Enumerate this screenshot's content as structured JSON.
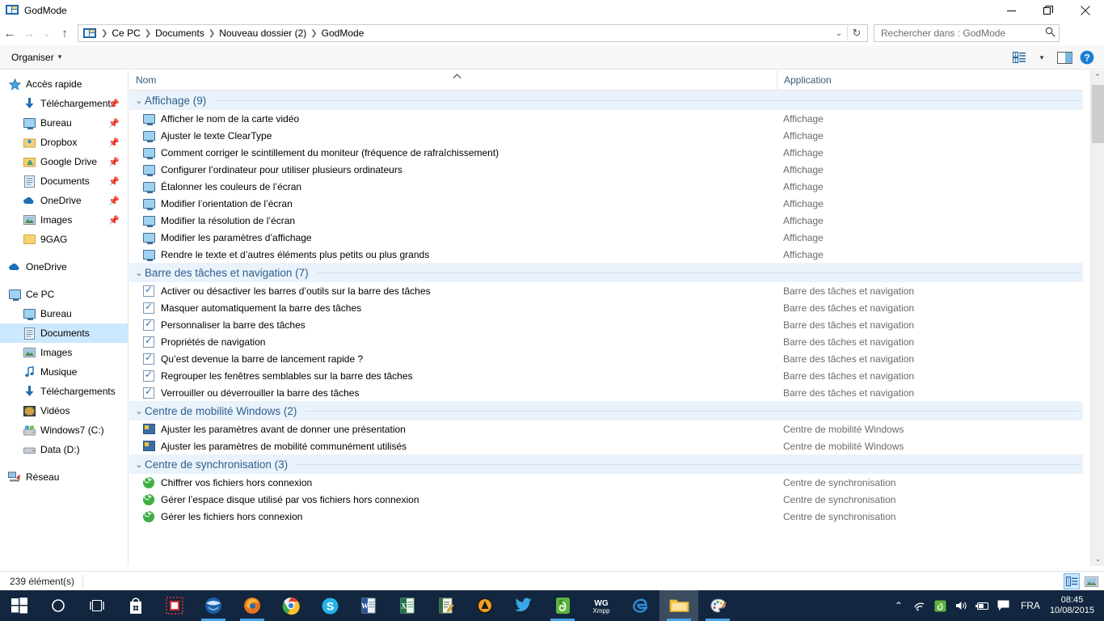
{
  "window": {
    "title": "GodMode",
    "icon": "godmode-icon",
    "controls": {
      "minimize": "—",
      "maximize": "❐",
      "close": "✕"
    }
  },
  "nav": {
    "back": "←",
    "forward": "→",
    "recent": "⌄",
    "up": "↑",
    "breadcrumbs": [
      "Ce PC",
      "Documents",
      "Nouveau dossier (2)",
      "GodMode"
    ],
    "dropdown": "⌄",
    "refresh": "↻",
    "search": {
      "placeholder": "Rechercher dans : GodMode",
      "value": "",
      "icon": "search-icon"
    }
  },
  "commandbar": {
    "organiser": "Organiser",
    "organiser_caret": "▾",
    "view_options": "view-options-icon",
    "view_caret": "▾",
    "preview_pane": "preview-pane-icon",
    "help": "?"
  },
  "sidebar": {
    "groups": [
      {
        "header": {
          "label": "Accès rapide",
          "icon": "star-icon",
          "level": 0
        },
        "items": [
          {
            "label": "Téléchargements",
            "icon": "download-arrow-icon",
            "pinned": true
          },
          {
            "label": "Bureau",
            "icon": "desktop-monitor-icon",
            "pinned": true
          },
          {
            "label": "Dropbox",
            "icon": "dropbox-icon",
            "pinned": true
          },
          {
            "label": "Google Drive",
            "icon": "google-drive-icon",
            "pinned": true
          },
          {
            "label": "Documents",
            "icon": "documents-icon",
            "pinned": true
          },
          {
            "label": "OneDrive",
            "icon": "onedrive-cloud-icon",
            "pinned": true
          },
          {
            "label": "Images",
            "icon": "pictures-icon",
            "pinned": true
          },
          {
            "label": "9GAG",
            "icon": "folder-icon",
            "pinned": false
          }
        ]
      },
      {
        "header": {
          "label": "OneDrive",
          "icon": "onedrive-cloud-icon",
          "level": 0
        },
        "items": []
      },
      {
        "header": {
          "label": "Ce PC",
          "icon": "this-pc-icon",
          "level": 0
        },
        "items": [
          {
            "label": "Bureau",
            "icon": "desktop-monitor-icon",
            "pinned": false
          },
          {
            "label": "Documents",
            "icon": "documents-icon",
            "pinned": false,
            "selected": true
          },
          {
            "label": "Images",
            "icon": "pictures-icon",
            "pinned": false
          },
          {
            "label": "Musique",
            "icon": "music-note-icon",
            "pinned": false
          },
          {
            "label": "Téléchargements",
            "icon": "download-arrow-icon",
            "pinned": false
          },
          {
            "label": "Vidéos",
            "icon": "videos-icon",
            "pinned": false
          },
          {
            "label": "Windows7 (C:)",
            "icon": "system-drive-icon",
            "pinned": false
          },
          {
            "label": "Data (D:)",
            "icon": "drive-icon",
            "pinned": false
          }
        ]
      },
      {
        "header": {
          "label": "Réseau",
          "icon": "network-icon",
          "level": 0
        },
        "items": []
      }
    ]
  },
  "list": {
    "columns": [
      {
        "label": "Nom",
        "sort": "asc"
      },
      {
        "label": "Application",
        "sort": null
      }
    ],
    "groups": [
      {
        "title": "Affichage (9)",
        "chevron": "⌄",
        "icon": "display-monitor-icon",
        "items": [
          {
            "name": "Afficher le nom de la carte vidéo",
            "app": "Affichage"
          },
          {
            "name": "Ajuster le texte ClearType",
            "app": "Affichage"
          },
          {
            "name": "Comment corriger le scintillement du moniteur (fréquence de rafraîchissement)",
            "app": "Affichage"
          },
          {
            "name": "Configurer l’ordinateur pour utiliser plusieurs ordinateurs",
            "app": "Affichage"
          },
          {
            "name": "Étalonner les couleurs de l’écran",
            "app": "Affichage"
          },
          {
            "name": "Modifier l’orientation de l’écran",
            "app": "Affichage"
          },
          {
            "name": "Modifier la résolution de l’écran",
            "app": "Affichage"
          },
          {
            "name": "Modifier les paramètres d’affichage",
            "app": "Affichage"
          },
          {
            "name": "Rendre le texte et d’autres éléments plus petits ou plus grands",
            "app": "Affichage"
          }
        ]
      },
      {
        "title": "Barre des tâches et navigation (7)",
        "chevron": "⌄",
        "icon": "taskbar-checkbox-icon",
        "items": [
          {
            "name": "Activer ou désactiver les barres d’outils sur la barre des tâches",
            "app": "Barre des tâches et navigation"
          },
          {
            "name": "Masquer automatiquement la barre des tâches",
            "app": "Barre des tâches et navigation"
          },
          {
            "name": "Personnaliser la barre des tâches",
            "app": "Barre des tâches et navigation"
          },
          {
            "name": "Propriétés de navigation",
            "app": "Barre des tâches et navigation"
          },
          {
            "name": "Qu’est devenue la barre de lancement rapide ?",
            "app": "Barre des tâches et navigation"
          },
          {
            "name": "Regrouper les fenêtres semblables sur la barre des tâches",
            "app": "Barre des tâches et navigation"
          },
          {
            "name": "Verrouiller ou déverrouiller la barre des tâches",
            "app": "Barre des tâches et navigation"
          }
        ]
      },
      {
        "title": "Centre de mobilité Windows (2)",
        "chevron": "⌄",
        "icon": "mobility-center-icon",
        "items": [
          {
            "name": "Ajuster les paramètres avant de donner une présentation",
            "app": "Centre de mobilité Windows"
          },
          {
            "name": "Ajuster les paramètres de mobilité communément utilisés",
            "app": "Centre de mobilité Windows"
          }
        ]
      },
      {
        "title": "Centre de synchronisation (3)",
        "chevron": "⌄",
        "icon": "sync-center-icon",
        "items": [
          {
            "name": "Chiffrer vos fichiers hors connexion",
            "app": "Centre de synchronisation"
          },
          {
            "name": "Gérer l’espace disque utilisé par vos fichiers hors connexion",
            "app": "Centre de synchronisation"
          },
          {
            "name": "Gérer les fichiers hors connexion",
            "app": "Centre de synchronisation"
          }
        ]
      }
    ]
  },
  "statusbar": {
    "item_count": "239 élément(s)",
    "views": [
      {
        "name": "details-view",
        "active": true
      },
      {
        "name": "large-icons-view",
        "active": false
      }
    ]
  },
  "taskbar": {
    "start": "start-button",
    "cortana": "cortana-search-icon",
    "taskview": "task-view-icon",
    "apps": [
      {
        "name": "microsoft-store",
        "label": "Store",
        "running": false,
        "active": false
      },
      {
        "name": "snipping-tool",
        "label": "Capture",
        "running": false,
        "active": false
      },
      {
        "name": "thunderbird",
        "label": "Thunderbird",
        "running": true,
        "active": false
      },
      {
        "name": "firefox",
        "label": "Firefox",
        "running": true,
        "active": false
      },
      {
        "name": "chrome",
        "label": "Chrome",
        "running": false,
        "active": false
      },
      {
        "name": "skype",
        "label": "Skype",
        "running": false,
        "active": false
      },
      {
        "name": "word",
        "label": "Word",
        "running": false,
        "active": false
      },
      {
        "name": "excel",
        "label": "Excel",
        "running": false,
        "active": false
      },
      {
        "name": "notes-app",
        "label": "Notes",
        "running": false,
        "active": false
      },
      {
        "name": "amule",
        "label": "aMule",
        "running": false,
        "active": false
      },
      {
        "name": "twitter",
        "label": "Twitter",
        "running": false,
        "active": false
      },
      {
        "name": "evernote",
        "label": "Evernote",
        "running": true,
        "active": false
      },
      {
        "name": "wg-xmpp",
        "label": "WG Xmpp",
        "running": false,
        "active": false
      },
      {
        "name": "edge",
        "label": "Microsoft Edge",
        "running": false,
        "active": false
      },
      {
        "name": "file-explorer",
        "label": "Explorateur de fichiers",
        "running": true,
        "active": true
      },
      {
        "name": "paint",
        "label": "Paint",
        "running": true,
        "active": false
      }
    ],
    "tray": {
      "show_hidden": "⌃",
      "network": "wifi-icon",
      "evernote": "evernote-tray-icon",
      "volume": "volume-icon",
      "battery": "battery-icon",
      "action_center": "action-center-icon",
      "language": "FRA",
      "time": "08:45",
      "date": "10/08/2015"
    }
  },
  "colors": {
    "accent": "#2e5e8e",
    "selection": "#cce8ff",
    "group_header_bg": "#eaf3fb",
    "taskbar": "#12263f"
  }
}
